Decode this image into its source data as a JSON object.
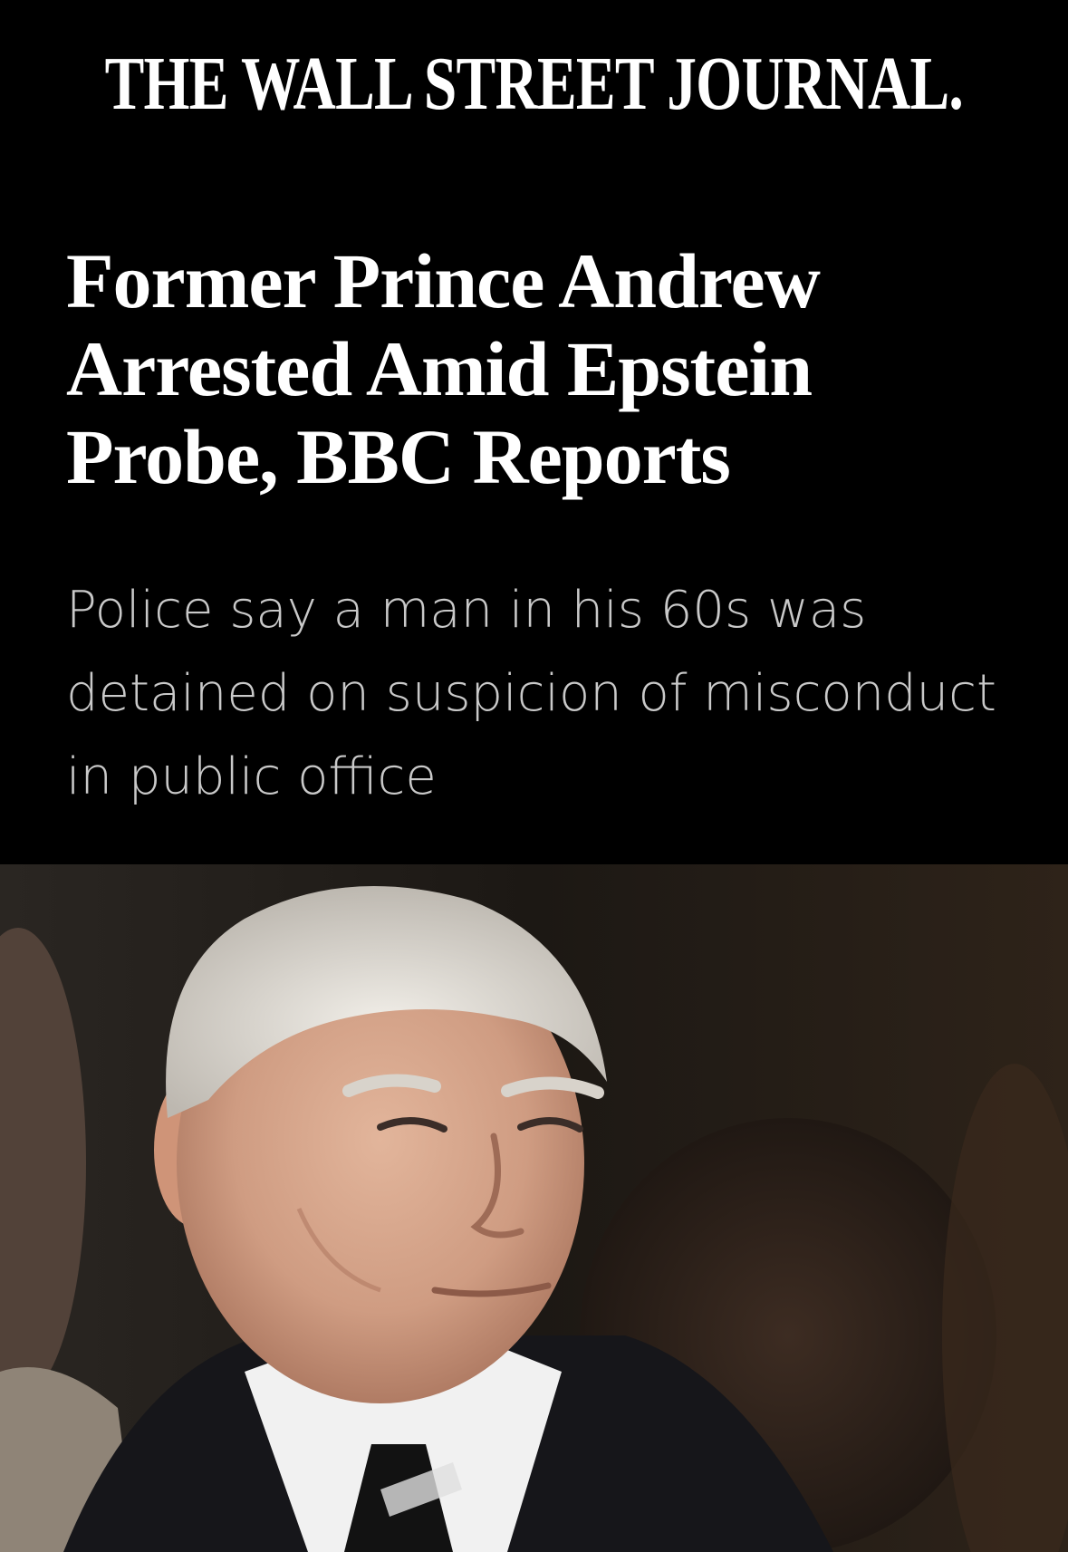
{
  "masthead": {
    "title": "THE WALL STREET JOURNAL."
  },
  "article": {
    "headline": "Former Prince Andrew Arrested Amid Epstein Probe, BBC Reports",
    "dek": "Police say a man in his 60s was detained on suspicion of misconduct in public office"
  },
  "colors": {
    "background": "#000000",
    "headline": "#ffffff",
    "dek": "#c9c9c9"
  }
}
